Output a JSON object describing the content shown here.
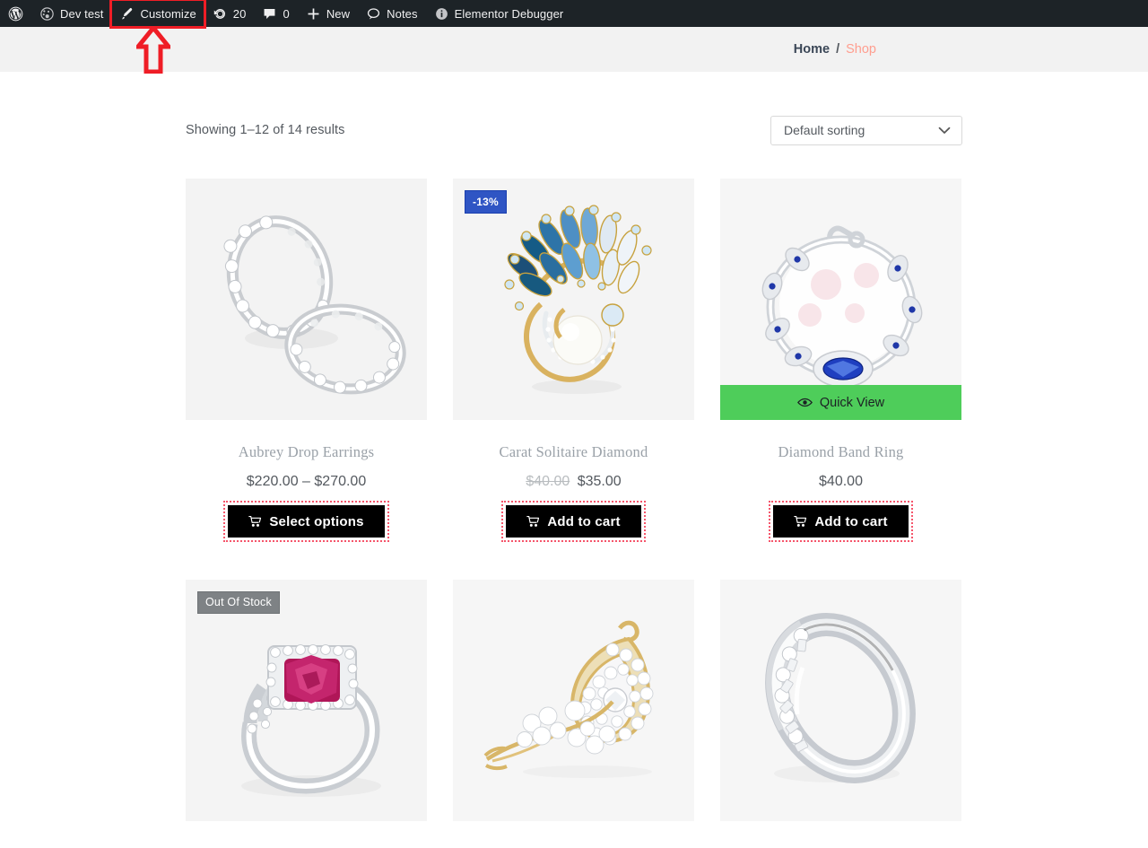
{
  "admin_bar": {
    "items": [
      {
        "icon": "wordpress-logo-icon",
        "label": "",
        "highlighted": false
      },
      {
        "icon": "dashboard-site-icon",
        "label": "Dev test",
        "highlighted": false
      },
      {
        "icon": "paintbrush-icon",
        "label": "Customize",
        "highlighted": true
      },
      {
        "icon": "updates-icon",
        "label": "20",
        "highlighted": false
      },
      {
        "icon": "comment-bubble-icon",
        "label": "0",
        "highlighted": false
      },
      {
        "icon": "plus-icon",
        "label": "New",
        "highlighted": false
      },
      {
        "icon": "notes-bubble-icon",
        "label": "Notes",
        "highlighted": false
      },
      {
        "icon": "info-circle-icon",
        "label": "Elementor Debugger",
        "highlighted": false
      }
    ],
    "highlight_color": "#ef1d26",
    "background": "#1d2327"
  },
  "annotation": {
    "arrow": "red-up-arrow",
    "color": "#ef1d26",
    "points_at": "Customize"
  },
  "breadcrumb": {
    "home_label": "Home",
    "separator": "/",
    "current_label": "Shop",
    "current_color": "#ff9e8f"
  },
  "toolbar": {
    "result_count": "Showing 1–12 of 14 results",
    "sorting": {
      "selected": "Default sorting",
      "chevron": "chevron-down-icon"
    }
  },
  "products": [
    {
      "title": "Aubrey Drop Earrings",
      "price": "$220.00 – $270.00",
      "price_old": "",
      "price_new": "",
      "button_label": "Select options",
      "badge": "",
      "badge_type": "",
      "quick_view": "",
      "image": "pair-of-diamond-eternity-bands"
    },
    {
      "title": "Carat Solitaire Diamond",
      "price": "",
      "price_old": "$40.00",
      "price_new": "$35.00",
      "button_label": "Add to cart",
      "badge": "-13%",
      "badge_type": "sale",
      "quick_view": "",
      "image": "blue-crystal-pearl-brooch"
    },
    {
      "title": "Diamond Band Ring",
      "price": "$40.00",
      "price_old": "",
      "price_new": "",
      "button_label": "Add to cart",
      "badge": "",
      "badge_type": "",
      "quick_view": "Quick View",
      "image": "sapphire-diamond-bracelet"
    },
    {
      "title": "",
      "price": "",
      "price_old": "",
      "price_new": "",
      "button_label": "",
      "badge": "Out Of Stock",
      "badge_type": "oos",
      "quick_view": "",
      "image": "pink-gemstone-halo-ring"
    },
    {
      "title": "",
      "price": "",
      "price_old": "",
      "price_new": "",
      "button_label": "",
      "badge": "",
      "badge_type": "",
      "quick_view": "",
      "image": "gold-diamond-floral-brooch"
    },
    {
      "title": "",
      "price": "",
      "price_old": "",
      "price_new": "",
      "button_label": "",
      "badge": "",
      "badge_type": "",
      "quick_view": "",
      "image": "diamond-channel-band-ring"
    }
  ],
  "colors": {
    "sale_badge": "#2f55c4",
    "oos_badge": "#7e8285",
    "quick_view": "#4ecd5a",
    "button_bg": "#000000",
    "button_outline": "#f5556b",
    "breadcrumb_band": "#f2f2f2",
    "media_bg": "#f3f3f3"
  }
}
